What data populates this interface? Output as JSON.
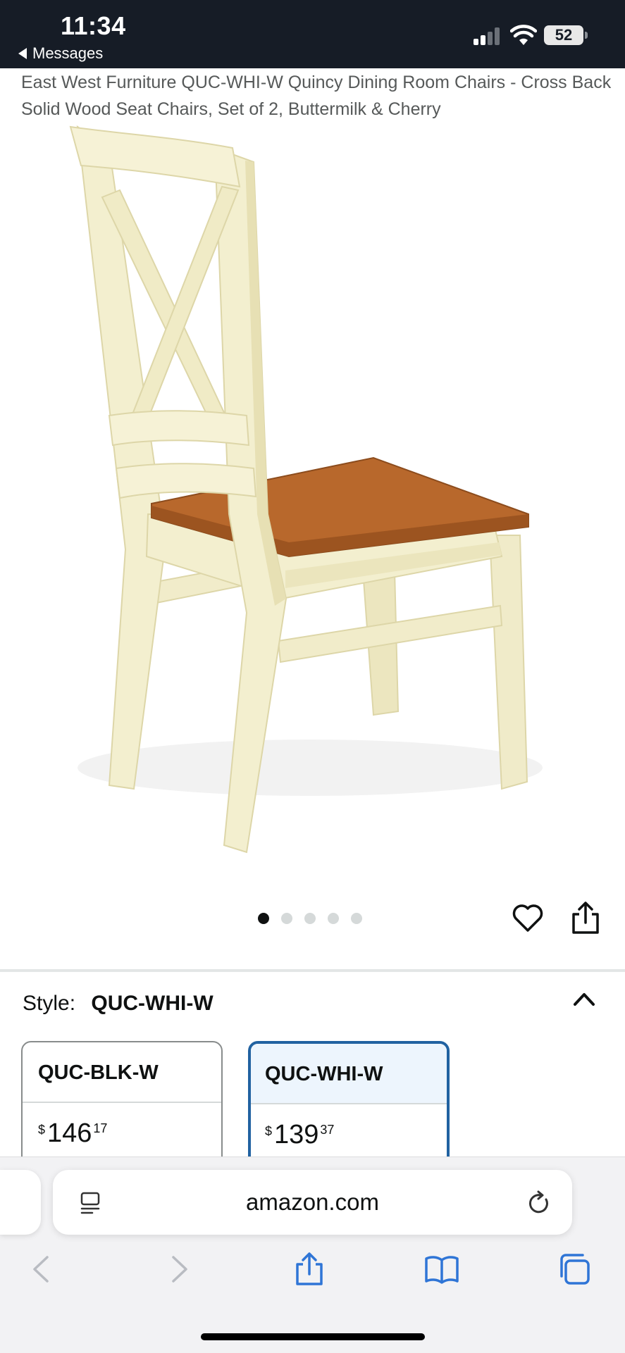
{
  "status_bar": {
    "time": "11:34",
    "back_app": "Messages",
    "battery": "52"
  },
  "product": {
    "title": "East West Furniture QUC-WHI-W Quincy Dining Room Chairs - Cross Back Solid Wood Seat Chairs, Set of 2, Buttermilk & Cherry",
    "image_alt": "Buttermilk and cherry cross back wooden dining chair",
    "carousel": {
      "total_images": 5,
      "active_index": 0
    },
    "colors": {
      "chair_frame": "#f3efcf",
      "seat": "#b8682c"
    }
  },
  "style_selector": {
    "label": "Style:",
    "selected_value": "QUC-WHI-W",
    "options": [
      {
        "name": "QUC-BLK-W",
        "price_symbol": "$",
        "price_whole": "146",
        "price_fraction": "17",
        "selected": false
      },
      {
        "name": "QUC-WHI-W",
        "price_symbol": "$",
        "price_whole": "139",
        "price_fraction": "37",
        "selected": true
      }
    ]
  },
  "browser": {
    "url": "amazon.com",
    "toolbar_icons": [
      "back-icon",
      "forward-icon",
      "share-icon",
      "bookmarks-icon",
      "tabs-icon"
    ]
  },
  "colors": {
    "status_bar_bg": "#161c26",
    "selected_border": "#2162a1",
    "selected_header_bg": "#edf5fd",
    "browser_icon": "#2f75d6"
  }
}
